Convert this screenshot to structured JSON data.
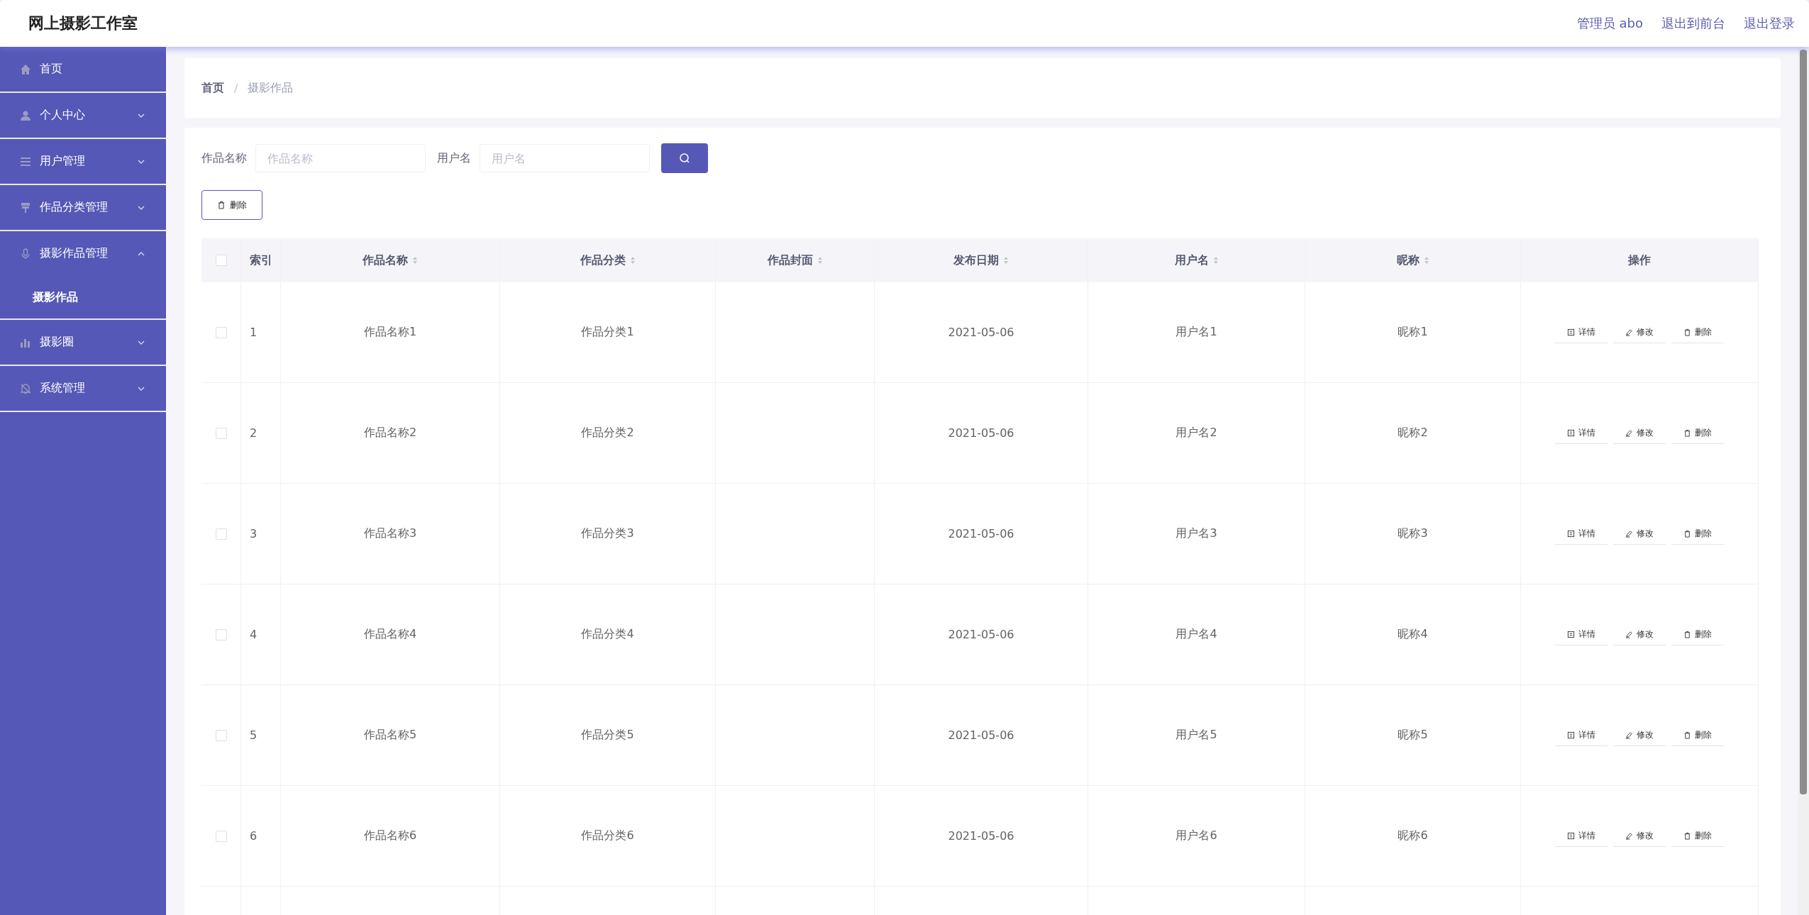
{
  "header": {
    "title": "网上摄影工作室",
    "links": [
      "管理员 abo",
      "退出到前台",
      "退出登录"
    ]
  },
  "sidebar": {
    "items": [
      {
        "label": "首页",
        "selected": false
      },
      {
        "label": "个人中心",
        "expanded": false
      },
      {
        "label": "用户管理",
        "expanded": false
      },
      {
        "label": "作品分类管理",
        "expanded": false
      },
      {
        "label": "摄影作品管理",
        "expanded": true,
        "children": [
          {
            "label": "摄影作品",
            "selected": true
          }
        ]
      },
      {
        "label": "摄影圈",
        "expanded": false
      },
      {
        "label": "系统管理",
        "expanded": false
      }
    ]
  },
  "breadcrumb": {
    "items": [
      "首页",
      "摄影作品"
    ],
    "separator": "/"
  },
  "search": {
    "fields": [
      {
        "label": "作品名称",
        "placeholder": "作品名称"
      },
      {
        "label": "用户名",
        "placeholder": "用户名"
      }
    ]
  },
  "toolbar": {
    "delete_button": "删除"
  },
  "table": {
    "header_checked": false,
    "columns": [
      {
        "label": "索引",
        "sortable": false
      },
      {
        "label": "作品名称",
        "sortable": true
      },
      {
        "label": "作品分类",
        "sortable": true
      },
      {
        "label": "作品封面",
        "sortable": true
      },
      {
        "label": "发布日期",
        "sortable": true
      },
      {
        "label": "用户名",
        "sortable": true
      },
      {
        "label": "昵称",
        "sortable": true
      },
      {
        "label": "操作",
        "sortable": false
      }
    ],
    "rows": [
      {
        "checked": false,
        "cells": [
          "1",
          "作品名称1",
          "作品分类1",
          "",
          "2021-05-06",
          "用户名1",
          "昵称1"
        ],
        "actions": [
          "详情",
          "修改",
          "删除"
        ]
      },
      {
        "checked": false,
        "cells": [
          "2",
          "作品名称2",
          "作品分类2",
          "",
          "2021-05-06",
          "用户名2",
          "昵称2"
        ],
        "actions": [
          "详情",
          "修改",
          "删除"
        ]
      },
      {
        "checked": false,
        "cells": [
          "3",
          "作品名称3",
          "作品分类3",
          "",
          "2021-05-06",
          "用户名3",
          "昵称3"
        ],
        "actions": [
          "详情",
          "修改",
          "删除"
        ]
      },
      {
        "checked": false,
        "cells": [
          "4",
          "作品名称4",
          "作品分类4",
          "",
          "2021-05-06",
          "用户名4",
          "昵称4"
        ],
        "actions": [
          "详情",
          "修改",
          "删除"
        ]
      },
      {
        "checked": false,
        "cells": [
          "5",
          "作品名称5",
          "作品分类5",
          "",
          "2021-05-06",
          "用户名5",
          "昵称5"
        ],
        "actions": [
          "详情",
          "修改",
          "删除"
        ]
      },
      {
        "checked": false,
        "cells": [
          "6",
          "作品名称6",
          "作品分类6",
          "",
          "2021-05-06",
          "用户名6",
          "昵称6"
        ],
        "actions": [
          "详情",
          "修改",
          "删除"
        ]
      }
    ]
  }
}
